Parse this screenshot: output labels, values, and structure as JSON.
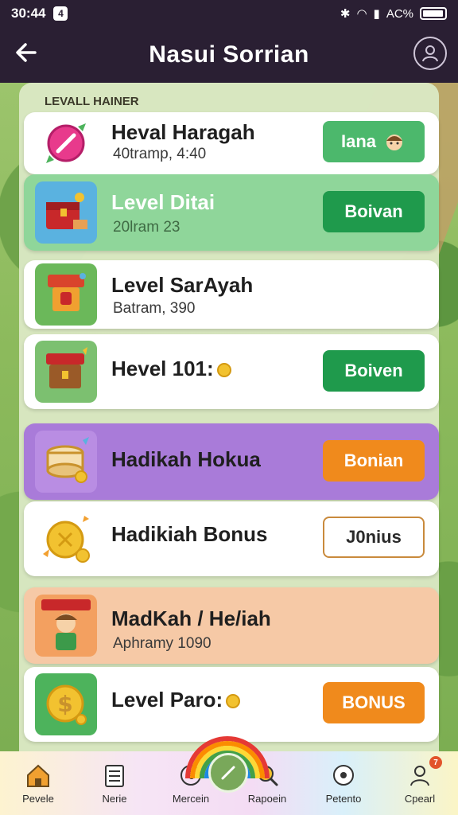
{
  "status_bar": {
    "time": "30:44",
    "notif": "4",
    "right_text": "AC%"
  },
  "header": {
    "title": "Nasui Sorrian"
  },
  "section_label": "LEVALL HAINER",
  "cards": [
    {
      "title": "Heval Haragah",
      "subtitle": "40tramp, 4:40",
      "button": "Iana",
      "bg": "#ffffff",
      "btn_color": "#4cb86c"
    },
    {
      "title": "Level Ditai",
      "subtitle": "20lram 23",
      "button": "Boivan",
      "bg": "#8fd69a",
      "btn_color": "#1f9a4c"
    },
    {
      "title": "Level SarAyah",
      "subtitle": "Batram, 390",
      "button": "",
      "bg": "#ffffff",
      "btn_color": ""
    },
    {
      "title": "Hevel 101:",
      "subtitle": "",
      "button": "Boiven",
      "bg": "#ffffff",
      "btn_color": "#1f9a4c"
    },
    {
      "title": "Hadikah Hokua",
      "subtitle": "",
      "button": "Bonian",
      "bg": "#a97bd9",
      "btn_color": "#f08a1c"
    },
    {
      "title": "Hadikiah Bonus",
      "subtitle": "",
      "button": "J0nius",
      "bg": "#ffffff",
      "btn_color": ""
    },
    {
      "title": "MadKah / He/iah",
      "subtitle": "Aphramy 1090",
      "button": "",
      "bg": "#f6c9a6",
      "btn_color": ""
    },
    {
      "title": "Level Paro:",
      "subtitle": "",
      "button": "BONUS",
      "bg": "#ffffff",
      "btn_color": "#f08a1c"
    }
  ],
  "nav": [
    {
      "label": "Pevele",
      "icon": "home-icon"
    },
    {
      "label": "Nerie",
      "icon": "list-icon"
    },
    {
      "label": "Mercein",
      "icon": "coin-icon"
    },
    {
      "label": "Rapoein",
      "icon": "search-icon"
    },
    {
      "label": "Petento",
      "icon": "face-icon"
    },
    {
      "label": "Cpearl",
      "icon": "user-icon"
    }
  ],
  "nav_badge": "7"
}
